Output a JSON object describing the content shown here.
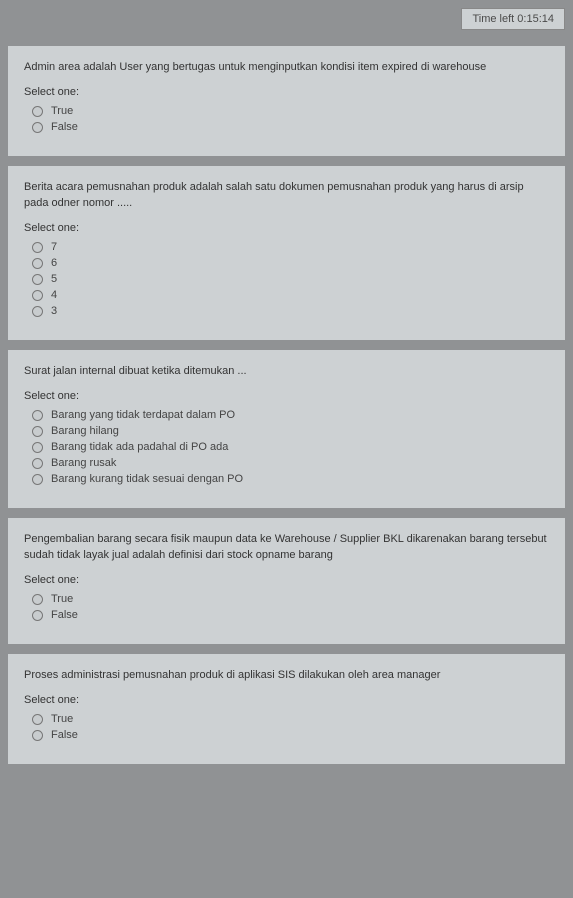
{
  "timer": {
    "label": "Time left 0:15:14"
  },
  "select_one_label": "Select one:",
  "options_true_false": {
    "true": "True",
    "false": "False"
  },
  "questions": {
    "q1": {
      "text": "Admin area adalah User yang bertugas untuk menginputkan kondisi item expired di warehouse"
    },
    "q2": {
      "text": "Berita acara pemusnahan produk adalah salah satu dokumen pemusnahan produk yang harus di arsip pada odner nomor .....",
      "options": {
        "o1": "7",
        "o2": "6",
        "o3": "5",
        "o4": "4",
        "o5": "3"
      }
    },
    "q3": {
      "text": "Surat jalan internal dibuat ketika ditemukan ...",
      "options": {
        "o1": "Barang yang tidak terdapat dalam PO",
        "o2": "Barang hilang",
        "o3": "Barang tidak ada padahal di PO ada",
        "o4": "Barang rusak",
        "o5": "Barang kurang tidak sesuai dengan PO"
      }
    },
    "q4": {
      "text": "Pengembalian barang secara fisik maupun data ke Warehouse / Supplier BKL dikarenakan barang tersebut sudah tidak layak jual adalah definisi dari stock opname barang"
    },
    "q5": {
      "text": "Proses administrasi pemusnahan produk di aplikasi SIS dilakukan oleh area manager"
    }
  }
}
